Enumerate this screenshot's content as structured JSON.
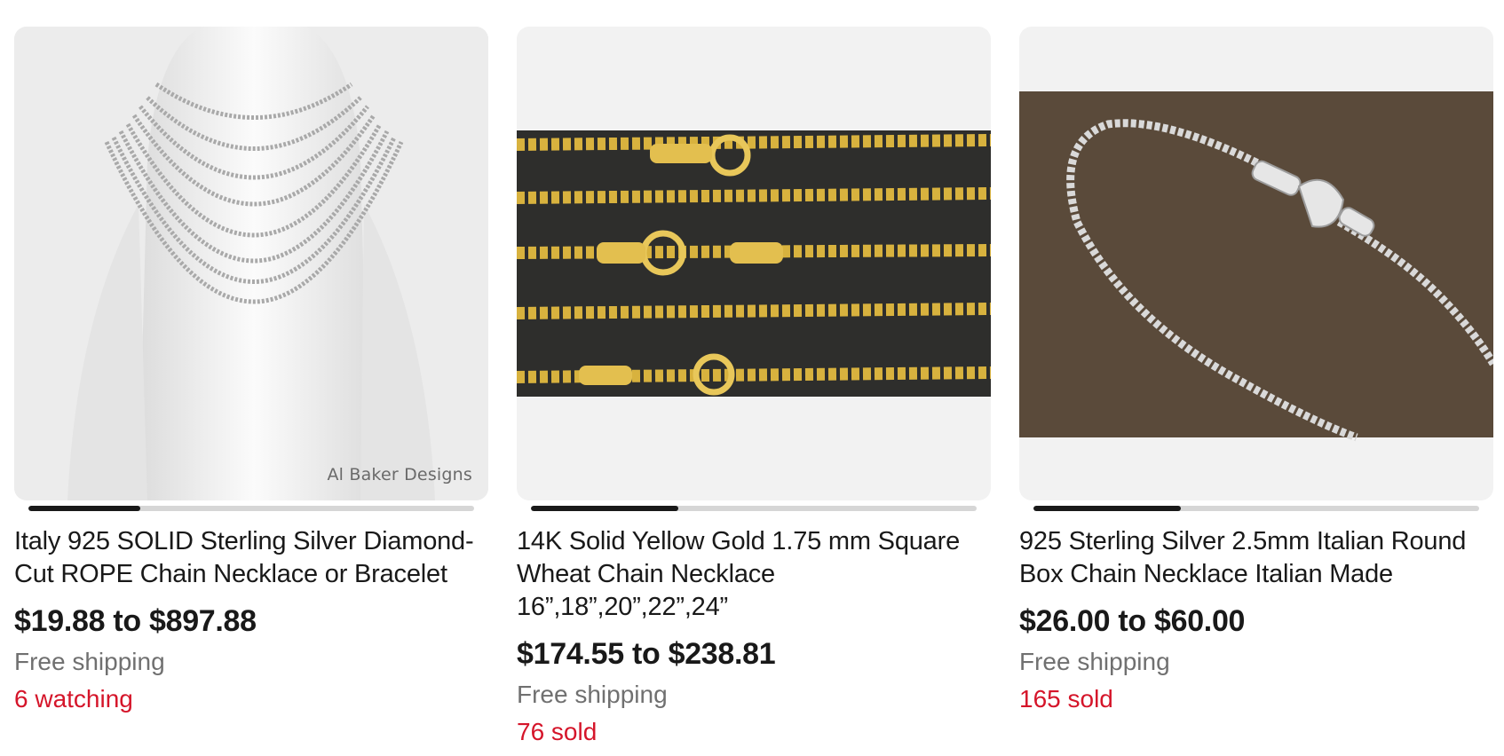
{
  "listings": [
    {
      "title": "Italy 925 SOLID Sterling Silver Diamond-Cut ROPE Chain Necklace or Bracelet",
      "price": "$19.88 to $897.88",
      "shipping": "Free shipping",
      "signal": "6 watching",
      "image_watermark": "Al Baker Designs",
      "image_icon": "silver-rope-chain-bust-image",
      "carousel_progress": 0.25
    },
    {
      "title": "14K Solid Yellow Gold 1.75 mm Square Wheat Chain Necklace 16”,18”,20”,22”,24”",
      "price": "$174.55 to $238.81",
      "shipping": "Free shipping",
      "signal": "76 sold",
      "image_icon": "gold-wheat-chain-image",
      "carousel_progress": 0.33
    },
    {
      "title": "925 Sterling Silver 2.5mm Italian Round Box Chain Necklace Italian Made",
      "price": "$26.00 to $60.00",
      "shipping": "Free shipping",
      "signal": "165 sold",
      "image_icon": "silver-box-chain-image",
      "carousel_progress": 0.33
    }
  ],
  "colors": {
    "text": "#191919",
    "secondary": "#707070",
    "signal": "#d5152a",
    "media_bg": "#f2f2f2"
  }
}
